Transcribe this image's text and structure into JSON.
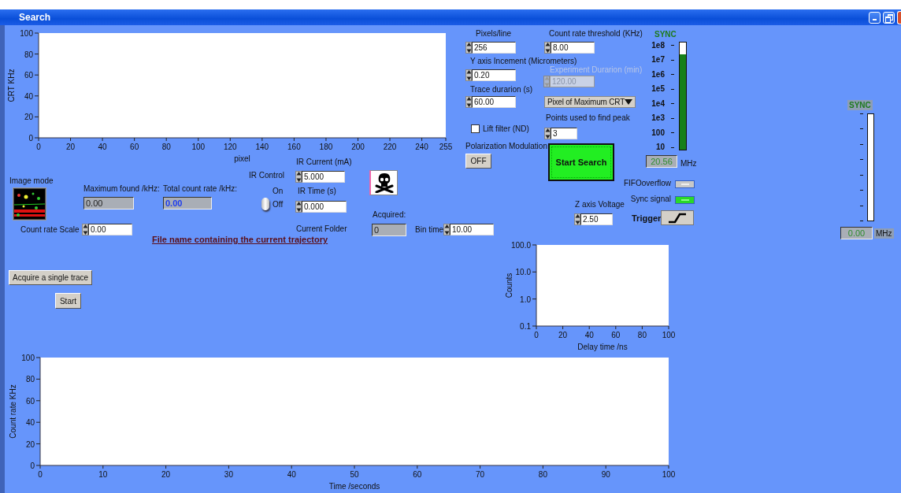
{
  "window": {
    "title": "Search"
  },
  "scan_chart": {
    "chart_data": {
      "type": "line",
      "xlabel": "pixel",
      "ylabel": "CRT KHz",
      "xlim": [
        0,
        255
      ],
      "ylim": [
        0,
        100
      ],
      "xticks": [
        0,
        20,
        40,
        60,
        80,
        100,
        120,
        140,
        160,
        180,
        200,
        220,
        240,
        255
      ],
      "yticks": [
        0,
        20,
        40,
        60,
        80,
        100
      ]
    }
  },
  "pixels_per_line": {
    "label": "Pixels/line",
    "value": "256"
  },
  "y_axis_increment": {
    "label": "Y axis Incement (Micrometers)",
    "value": "0.20"
  },
  "trace_duration": {
    "label": "Trace durarion (s)",
    "value": "60.00"
  },
  "lift_filter": {
    "label": "Lift filter (ND)",
    "checked": false
  },
  "polarization_modulation": {
    "label": "Polarization Modulation",
    "button": "OFF"
  },
  "count_rate_threshold": {
    "label": "Count rate threshold (KHz)",
    "value": "8.00"
  },
  "experiment_duration": {
    "label": "Experiment Durarion (min)",
    "value": "120.00",
    "disabled": true
  },
  "peak_mode": {
    "value": "Pixel of Maximum CRT"
  },
  "points_for_peak": {
    "label": "Points used to find peak",
    "value": "3"
  },
  "start_search": {
    "label": "Start Search"
  },
  "sync_meter": {
    "title": "SYNC",
    "scale": [
      "1e8",
      "1e7",
      "1e6",
      "1e5",
      "1e4",
      "1e3",
      "100",
      "10"
    ],
    "level": 0.89,
    "reading": "20.56",
    "unit": "MHz"
  },
  "fifo_overflow": {
    "label": "FIFOoverflow",
    "on": false
  },
  "sync_signal": {
    "label": "Sync signal",
    "on": true
  },
  "trigger": {
    "label": "Trigger"
  },
  "z_axis_voltage": {
    "label": "Z axis Voltage",
    "value": "2.50"
  },
  "image_mode": {
    "label": "Image mode"
  },
  "count_rate_scale": {
    "label": "Count rate Scale",
    "value": "0.00"
  },
  "maximum_found": {
    "label": "Maximum found /kHz:",
    "value": "0.00"
  },
  "total_count_rate": {
    "label": "Total count rate /kHz:",
    "value": "0.00"
  },
  "ir_control": {
    "label": "IR Control",
    "on_label": "On",
    "off_label": "Off",
    "on": false
  },
  "ir_current": {
    "label": "IR Current (mA)",
    "value": "5.000"
  },
  "ir_time": {
    "label": "IR Time (s)",
    "value": "0.000"
  },
  "current_folder": {
    "label": "Current Folder"
  },
  "file_name_link": "File name containing the current trajectory",
  "acquired": {
    "label": "Acquired:",
    "value": "0"
  },
  "bin_time": {
    "label": "Bin time",
    "value": "10.00"
  },
  "acquire_single_trace": "Acquire a single trace",
  "start": "Start",
  "histogram_chart": {
    "xlabel": "Delay time /ns",
    "ylabel": "Counts",
    "x_tick_labels": [
      "0",
      "20",
      "40",
      "60",
      "80",
      "100"
    ],
    "y_tick_labels": [
      "100.0",
      "10.0",
      "1.0",
      "0.1"
    ]
  },
  "trace_chart": {
    "chart_data": {
      "type": "line",
      "xlabel": "Time /seconds",
      "ylabel": "Count rate KHz",
      "xlim": [
        0,
        100
      ],
      "ylim": [
        0,
        100
      ],
      "xticks": [
        0,
        10,
        20,
        30,
        40,
        50,
        60,
        70,
        80,
        90,
        100
      ],
      "yticks": [
        0,
        20,
        40,
        60,
        80,
        100
      ]
    }
  },
  "sync_meter_2": {
    "title": "SYNC",
    "level": 0,
    "reading": "0.00",
    "unit": "MHz"
  }
}
